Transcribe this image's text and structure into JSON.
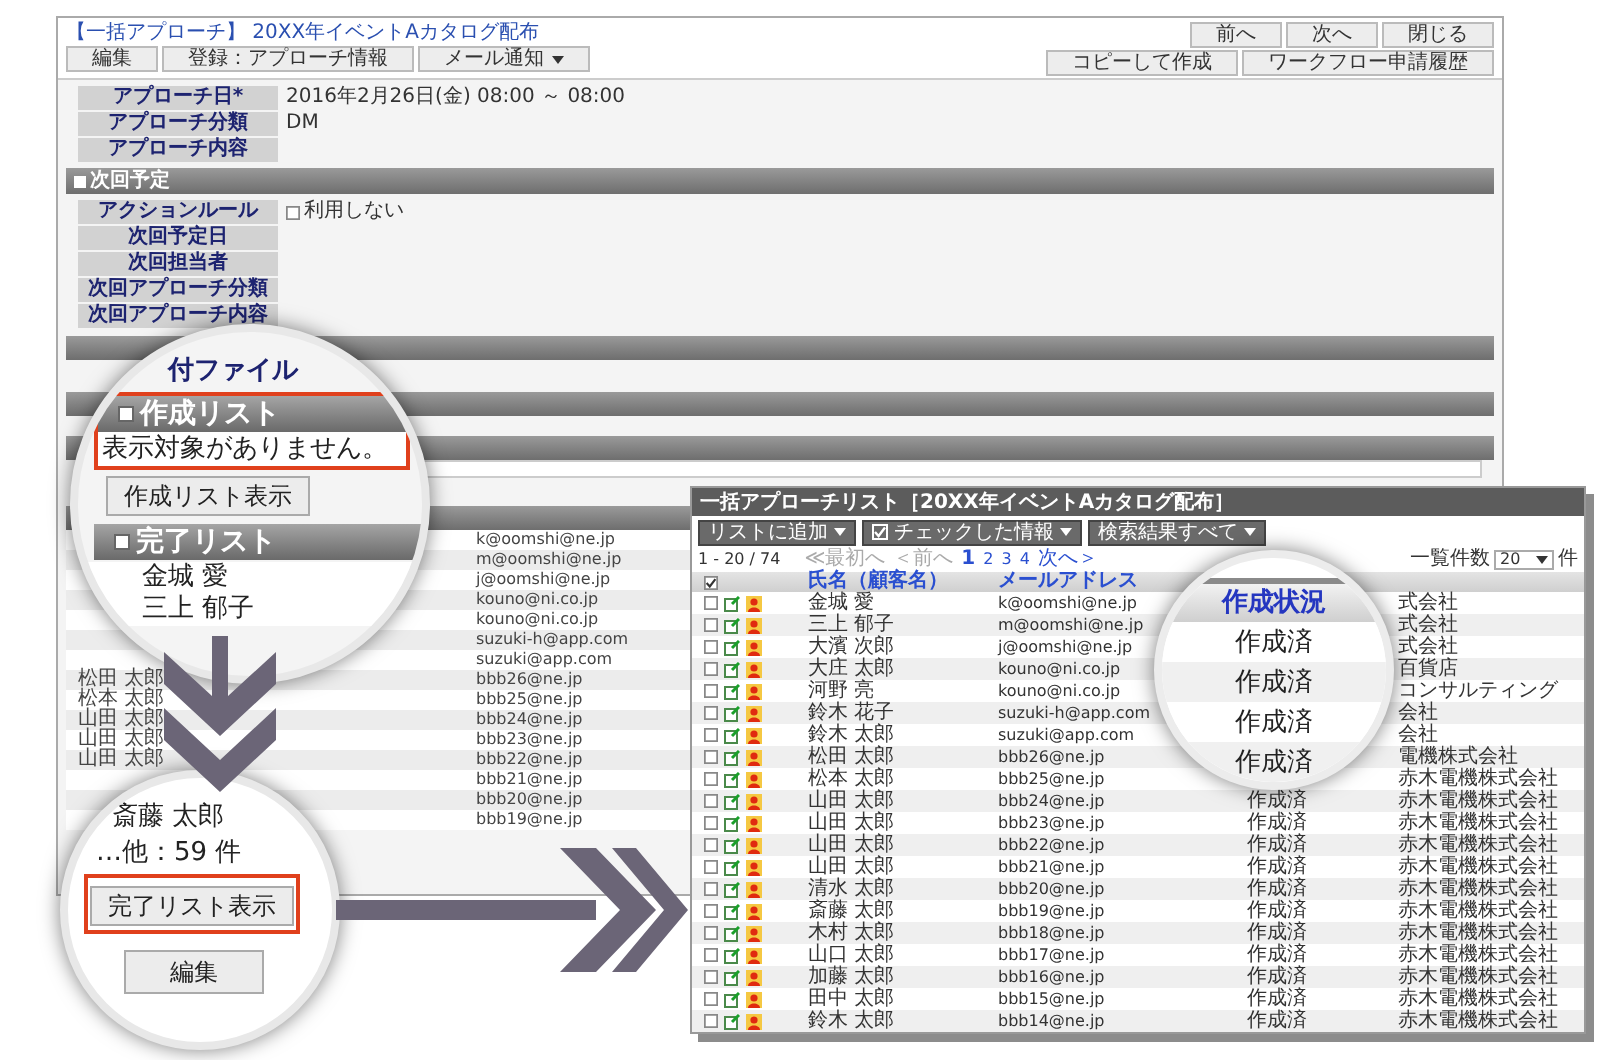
{
  "detail_window": {
    "title": "【一括アプローチ】 20XX年イベントAカタログ配布",
    "nav_buttons": [
      "前へ",
      "次へ",
      "閉じる"
    ],
    "toolbar": [
      {
        "label": "編集",
        "kind": "button"
      },
      {
        "label": "登録：アプローチ情報",
        "kind": "button"
      },
      {
        "label": "メール通知",
        "kind": "dropdown"
      }
    ],
    "right_buttons": [
      "コピーして作成",
      "ワークフロー申請履歴"
    ],
    "fields": [
      {
        "label": "アプローチ日*",
        "value": "2016年2月26日(金) 08:00 ～ 08:00"
      },
      {
        "label": "アプローチ分類",
        "value": "DM"
      },
      {
        "label": "アプローチ内容"
      }
    ],
    "next_section": {
      "title": "次回予定",
      "fields": [
        {
          "label": "アクションルール",
          "kind": "checkbox",
          "checked": false,
          "value": "利用しない"
        },
        {
          "label": "次回予定日",
          "kind": "text"
        },
        {
          "label": "次回担当者",
          "kind": "text"
        },
        {
          "label": "次回アプローチ分類",
          "kind": "text"
        },
        {
          "label": "次回アプローチ内容",
          "kind": "text"
        }
      ]
    },
    "list": [
      {
        "email": "k@oomshi@ne.jp"
      },
      {
        "email": "m@oomshi@ne.jp"
      },
      {
        "email": "j@oomshi@ne.jp"
      },
      {
        "email": "kouno@ni.co.jp"
      },
      {
        "email": "kouno@ni.co.jp"
      },
      {
        "email": "suzuki-h@app.com"
      },
      {
        "email": "suzuki@app.com"
      },
      {
        "name": "松田 太郎",
        "email": "bbb26@ne.jp"
      },
      {
        "name": "松本 太郎",
        "email": "bbb25@ne.jp"
      },
      {
        "name": "山田 太郎",
        "email": "bbb24@ne.jp"
      },
      {
        "name": "山田 太郎",
        "email": "bbb23@ne.jp"
      },
      {
        "name": "山田 太郎",
        "email": "bbb22@ne.jp"
      },
      {
        "email": "bbb21@ne.jp"
      },
      {
        "email": "bbb20@ne.jp"
      },
      {
        "email": "bbb19@ne.jp"
      }
    ]
  },
  "creation_magnifier": {
    "partial_heading": "付ファイル",
    "section_title": "作成リスト",
    "message": "表示対象がありません。",
    "button": "作成リスト表示",
    "done_title": "完了リスト",
    "names": [
      "金城 愛",
      "三上 郁子"
    ]
  },
  "done_magnifier": {
    "partial_name": "斎藤 太郎",
    "count": "…他：59 件",
    "button": "完了リスト表示",
    "edit_button": "編集"
  },
  "list_window": {
    "title": "一括アプローチリスト［20XX年イベントAカタログ配布］",
    "toolbar": [
      {
        "label": "リストに追加",
        "kind": "dropdown"
      },
      {
        "label": "チェックした情報",
        "kind": "checked-dropdown"
      },
      {
        "label": "検索結果すべて",
        "kind": "dropdown"
      }
    ],
    "range": "1 - 20 / 74",
    "links": [
      {
        "label": "≪最初へ",
        "kind": "nav",
        "disabled": true
      },
      {
        "label": "＜前へ",
        "kind": "nav",
        "disabled": true
      },
      {
        "label": "1",
        "kind": "page",
        "selected": true
      },
      {
        "label": "2",
        "kind": "page",
        "selected": false
      },
      {
        "label": "3",
        "kind": "page",
        "selected": false
      },
      {
        "label": "4",
        "kind": "page",
        "selected": false
      },
      {
        "label": "次へ＞",
        "kind": "nav",
        "disabled": false
      }
    ],
    "page_size": {
      "label": "一覧件数",
      "value": "20",
      "unit": "件"
    },
    "header_checkbox": {
      "checked": true
    },
    "columns": [
      "氏名（顧客名）",
      "メールアドレス"
    ],
    "rows": [
      {
        "checked": false,
        "name": "金城 愛",
        "email": "k@oomshi@ne.jp",
        "company": "式会社"
      },
      {
        "checked": false,
        "name": "三上 郁子",
        "email": "m@oomshi@ne.jp",
        "company": "式会社"
      },
      {
        "checked": false,
        "name": "大濱 次郎",
        "email": "j@oomshi@ne.jp",
        "company": "式会社"
      },
      {
        "checked": false,
        "name": "大庄 太郎",
        "email": "kouno@ni.co.jp",
        "company": "百貨店"
      },
      {
        "checked": false,
        "name": "河野 亮",
        "email": "kouno@ni.co.jp",
        "company": "コンサルティング"
      },
      {
        "checked": false,
        "name": "鈴木 花子",
        "email": "suzuki-h@app.com",
        "company": "会社"
      },
      {
        "checked": false,
        "name": "鈴木 太郎",
        "email": "suzuki@app.com",
        "company": "会社"
      },
      {
        "checked": false,
        "name": "松田 太郎",
        "email": "bbb26@ne.jp",
        "company": "電機株式会社"
      },
      {
        "checked": false,
        "name": "松本 太郎",
        "email": "bbb25@ne.jp",
        "company": "赤木電機株式会社"
      },
      {
        "checked": false,
        "name": "山田 太郎",
        "email": "bbb24@ne.jp",
        "status": "作成済",
        "company": "赤木電機株式会社"
      },
      {
        "checked": false,
        "name": "山田 太郎",
        "email": "bbb23@ne.jp",
        "status": "作成済",
        "company": "赤木電機株式会社"
      },
      {
        "checked": false,
        "name": "山田 太郎",
        "email": "bbb22@ne.jp",
        "status": "作成済",
        "company": "赤木電機株式会社"
      },
      {
        "checked": false,
        "name": "山田 太郎",
        "email": "bbb21@ne.jp",
        "status": "作成済",
        "company": "赤木電機株式会社"
      },
      {
        "checked": false,
        "name": "清水 太郎",
        "email": "bbb20@ne.jp",
        "status": "作成済",
        "company": "赤木電機株式会社"
      },
      {
        "checked": false,
        "name": "斎藤 太郎",
        "email": "bbb19@ne.jp",
        "status": "作成済",
        "company": "赤木電機株式会社"
      },
      {
        "checked": false,
        "name": "木村 太郎",
        "email": "bbb18@ne.jp",
        "status": "作成済",
        "company": "赤木電機株式会社"
      },
      {
        "checked": false,
        "name": "山口 太郎",
        "email": "bbb17@ne.jp",
        "status": "作成済",
        "company": "赤木電機株式会社"
      },
      {
        "checked": false,
        "name": "加藤 太郎",
        "email": "bbb16@ne.jp",
        "status": "作成済",
        "company": "赤木電機株式会社"
      },
      {
        "checked": false,
        "name": "田中 太郎",
        "email": "bbb15@ne.jp",
        "status": "作成済",
        "company": "赤木電機株式会社"
      },
      {
        "checked": false,
        "name": "鈴木 太郎",
        "email": "bbb14@ne.jp",
        "status": "作成済",
        "company": "赤木電機株式会社"
      }
    ]
  },
  "status_magnifier": {
    "header": "作成状況",
    "values": [
      "作成済",
      "作成済",
      "作成済",
      "作成済"
    ]
  }
}
